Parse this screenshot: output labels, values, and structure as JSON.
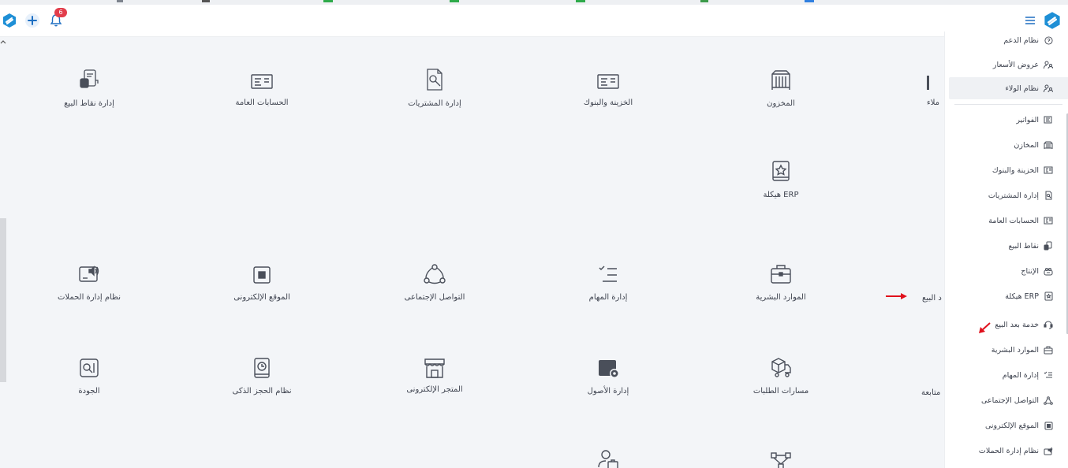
{
  "top_bar": {
    "notification_count": "6"
  },
  "tiles": {
    "pos_management": "إدارة نقاط البيع",
    "general_accounts": "الحسابات العامة",
    "purchases_management": "إدارة المشتريات",
    "treasury_banks": "الخزينة والبنوك",
    "warehouse": "المخزون",
    "customers_partial": "ملاء",
    "erp_structure": "هيكلة ERP",
    "campaigns_system": "نظام إدارة الحملات",
    "website": "الموقع الإلكترونى",
    "social_communication": "التواصل الإجتماعى",
    "tasks_management": "إدارة المهام",
    "human_resources": "الموارد البشرية",
    "after_sales_partial": "د البيع",
    "quality": "الجودة",
    "smart_booking": "نظام الحجز الذكى",
    "online_store": "المتجر الإلكترونى",
    "assets_management": "إدارة الأصول",
    "order_paths": "مسارات الطلبات",
    "follow_up_partial": "متابعة"
  },
  "sidebar": {
    "items": [
      {
        "label": "نظام الدعم",
        "icon": "help-icon"
      },
      {
        "label": "عروض الأسعار",
        "icon": "users-icon"
      },
      {
        "label": "نظام الولاء",
        "icon": "users-icon"
      },
      {
        "label": "الفواتير",
        "icon": "invoice-icon"
      },
      {
        "label": "المخازن",
        "icon": "warehouse-icon"
      },
      {
        "label": "الخزينة والبنوك",
        "icon": "bank-icon"
      },
      {
        "label": "إدارة المشتريات",
        "icon": "purchase-icon"
      },
      {
        "label": "الحسابات العامة",
        "icon": "accounts-icon"
      },
      {
        "label": "نقاط البيع",
        "icon": "pos-icon"
      },
      {
        "label": "الإنتاج",
        "icon": "production-icon"
      },
      {
        "label": "هيكلة ERP",
        "icon": "erp-icon"
      },
      {
        "label": "خدمة بعد البيع",
        "icon": "headset-icon"
      },
      {
        "label": "الموارد البشرية",
        "icon": "briefcase-icon"
      },
      {
        "label": "إدارة المهام",
        "icon": "tasks-icon"
      },
      {
        "label": "التواصل الإجتماعى",
        "icon": "social-icon"
      },
      {
        "label": "الموقع الإلكترونى",
        "icon": "website-icon"
      },
      {
        "label": "نظام إدارة الحملات",
        "icon": "campaign-icon"
      }
    ]
  },
  "colors": {
    "brand": "#1e8fd6",
    "accent_red": "#e0101c",
    "background": "#f3f5f8"
  }
}
